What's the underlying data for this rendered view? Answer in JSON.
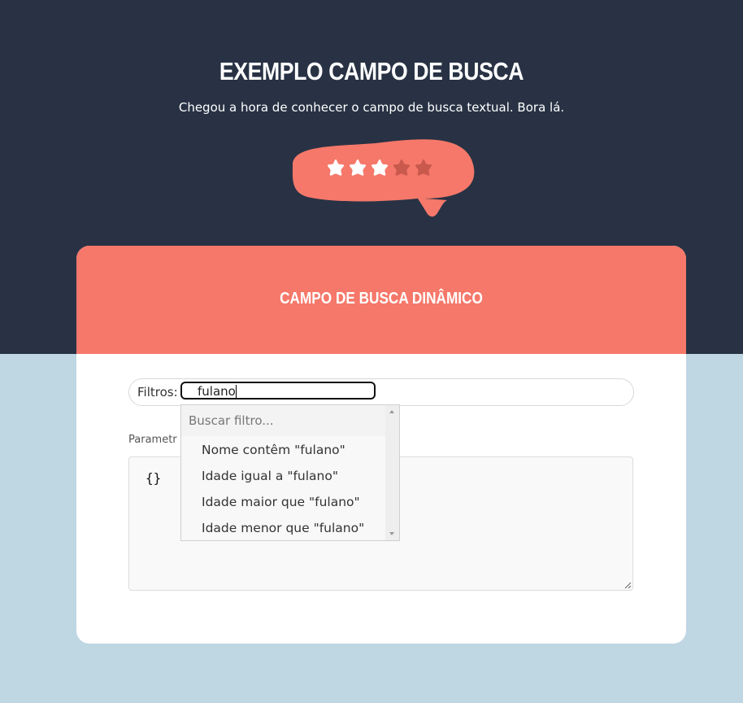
{
  "hero": {
    "title": "EXEMPLO CAMPO DE BUSCA",
    "subtitle": "Chegou a hora de conhecer o campo de busca textual. Bora lá.",
    "rating": {
      "value": 3,
      "max": 5
    }
  },
  "card": {
    "title": "CAMPO DE BUSCA DINÂMICO",
    "filter": {
      "label": "Filtros:",
      "value": "fulano"
    },
    "params": {
      "label": "Parametr",
      "value": "{}"
    },
    "dropdown": {
      "search_placeholder": "Buscar filtro...",
      "options": [
        "Nome contêm \"fulano\"",
        "Idade igual a \"fulano\"",
        "Idade maior que \"fulano\"",
        "Idade menor que \"fulano\""
      ]
    }
  },
  "colors": {
    "dark_band": "#283244",
    "accent": "#f5786a",
    "page_bg": "#bfd6e3",
    "star_on": "#ffffff",
    "star_off": "#c9584d"
  }
}
